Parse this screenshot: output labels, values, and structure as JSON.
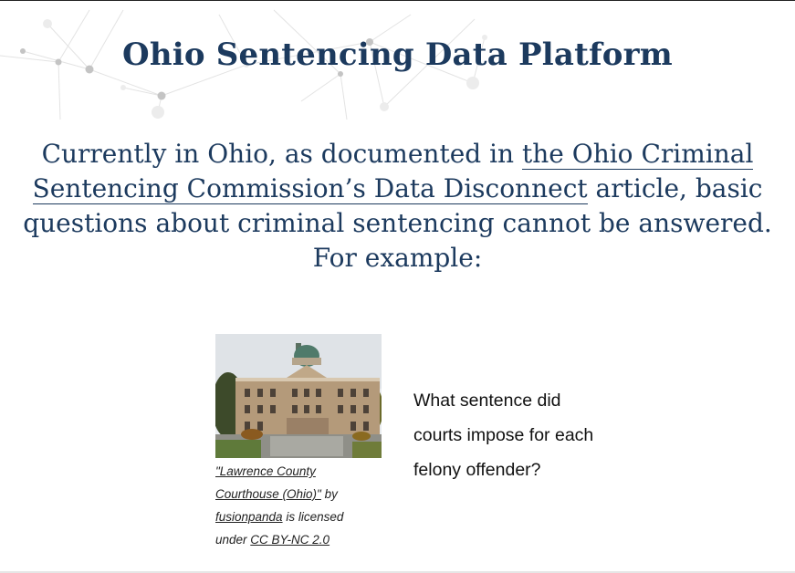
{
  "header": {
    "title": "Ohio Sentencing Data Platform"
  },
  "intro": {
    "text_before": "Currently in Ohio, as documented in ",
    "link_text": "the Ohio Criminal Sentencing Commission’s Data Disconnect",
    "text_after": " article, basic questions about criminal sentencing cannot be answered. For example:"
  },
  "image_card": {
    "caption_link_title": "\"Lawrence County Courthouse (Ohio)\"",
    "caption_by": " by ",
    "caption_author": "fusionpanda",
    "caption_licensed": " is licensed under ",
    "caption_license": "CC BY-NC 2.0"
  },
  "question": {
    "text": "What sentence did courts impose for each felony offender?"
  },
  "colors": {
    "brand_navy": "#1c3a5e",
    "link_underline": "#1c3a5e",
    "network_gray": "#cfcfcf"
  }
}
